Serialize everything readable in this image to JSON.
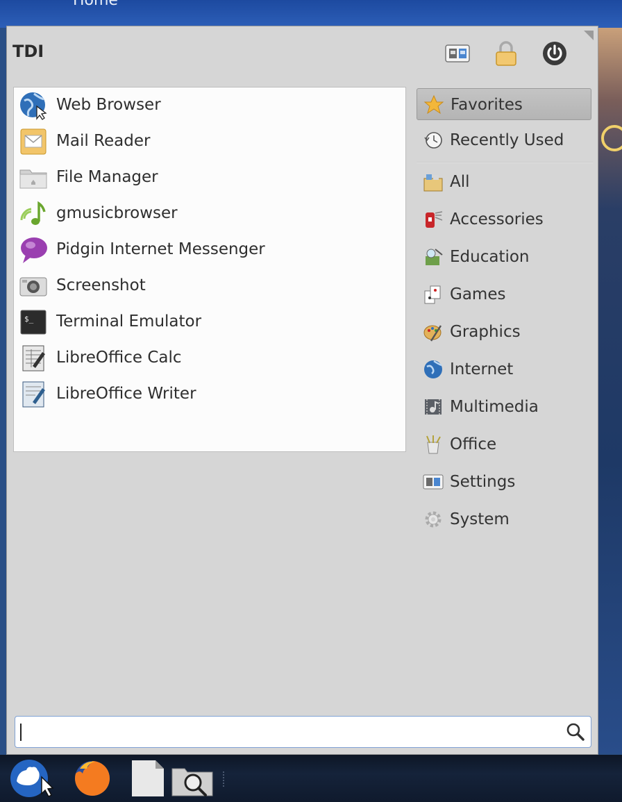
{
  "desktop": {
    "top_label": "Home"
  },
  "menu": {
    "user_name": "TDI",
    "header_buttons": [
      {
        "icon": "settings-manager-icon"
      },
      {
        "icon": "lock-screen-icon"
      },
      {
        "icon": "power-icon"
      }
    ]
  },
  "favorites": [
    {
      "label": "Web Browser",
      "icon": "web-browser-icon"
    },
    {
      "label": "Mail Reader",
      "icon": "mail-reader-icon"
    },
    {
      "label": "File Manager",
      "icon": "file-manager-icon"
    },
    {
      "label": "gmusicbrowser",
      "icon": "music-note-icon"
    },
    {
      "label": "Pidgin Internet Messenger",
      "icon": "pidgin-icon"
    },
    {
      "label": "Screenshot",
      "icon": "camera-icon"
    },
    {
      "label": "Terminal Emulator",
      "icon": "terminal-icon"
    },
    {
      "label": "LibreOffice Calc",
      "icon": "libreoffice-calc-icon"
    },
    {
      "label": "LibreOffice Writer",
      "icon": "libreoffice-writer-icon"
    }
  ],
  "categories": [
    {
      "label": "Favorites",
      "icon": "star-icon",
      "selected": true
    },
    {
      "label": "Recently Used",
      "icon": "clock-icon",
      "selected": false
    },
    {
      "label": "All",
      "icon": "all-apps-icon",
      "selected": false
    },
    {
      "label": "Accessories",
      "icon": "accessories-icon",
      "selected": false
    },
    {
      "label": "Education",
      "icon": "education-icon",
      "selected": false
    },
    {
      "label": "Games",
      "icon": "games-icon",
      "selected": false
    },
    {
      "label": "Graphics",
      "icon": "graphics-icon",
      "selected": false
    },
    {
      "label": "Internet",
      "icon": "globe-icon",
      "selected": false
    },
    {
      "label": "Multimedia",
      "icon": "multimedia-icon",
      "selected": false
    },
    {
      "label": "Office",
      "icon": "office-icon",
      "selected": false
    },
    {
      "label": "Settings",
      "icon": "settings-icon",
      "selected": false
    },
    {
      "label": "System",
      "icon": "gear-icon",
      "selected": false
    }
  ],
  "search": {
    "value": "",
    "placeholder": ""
  },
  "taskbar": [
    {
      "icon": "whisker-menu-icon"
    },
    {
      "icon": "firefox-icon"
    },
    {
      "icon": "blank-file-icon"
    },
    {
      "icon": "app-finder-icon"
    }
  ],
  "colors": {
    "menu_bg": "#d6d6d6",
    "apps_bg": "#fcfcfc",
    "selected_bg": "#bcbcbc",
    "search_border": "#7fa1d4",
    "taskbar_bg": "#15233a"
  }
}
